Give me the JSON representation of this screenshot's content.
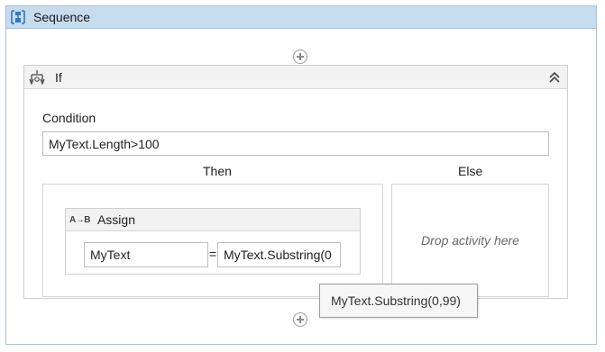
{
  "sequence": {
    "title": "Sequence",
    "icon": "sequence-icon"
  },
  "if_activity": {
    "title": "If",
    "icon": "if-icon",
    "collapse_icon": "double-chevron-up-icon",
    "condition_label": "Condition",
    "condition_value": "MyText.Length>100",
    "then_label": "Then",
    "else_label": "Else",
    "else_placeholder": "Drop activity here"
  },
  "assign_activity": {
    "title": "Assign",
    "icon_text": "A→B",
    "left_value": "MyText",
    "equals": "=",
    "right_value": "MyText.Substring(0"
  },
  "tooltip": {
    "text": "MyText.Substring(0,99)"
  },
  "colors": {
    "sequence_header": "#c6dcef",
    "sequence_border": "#a9bfd6",
    "activity_header": "#f2f2f2",
    "icon_blue": "#2f78c4"
  }
}
